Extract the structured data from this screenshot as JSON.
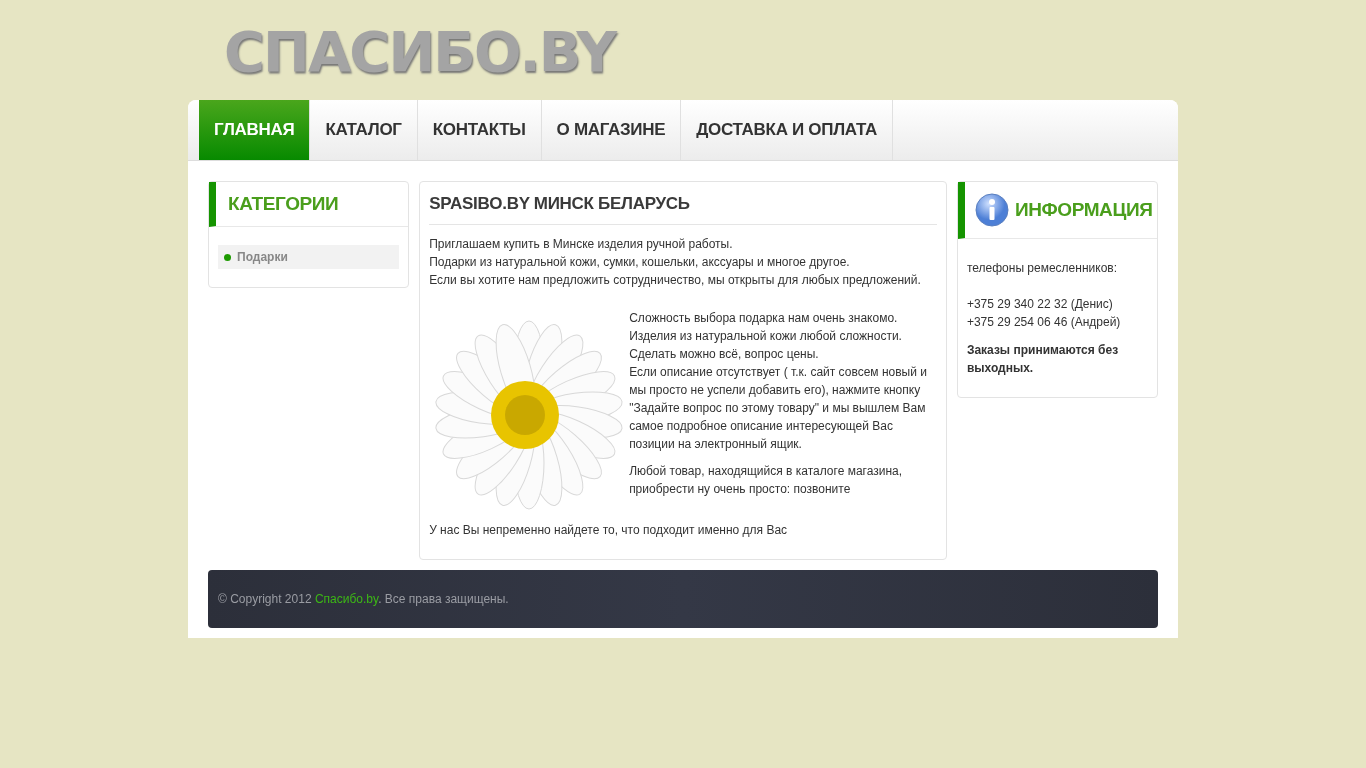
{
  "logo": {
    "text": "СПАСИБО.BY"
  },
  "nav": [
    {
      "label": "ГЛАВНАЯ",
      "selected": true
    },
    {
      "label": "КАТАЛОГ",
      "selected": false
    },
    {
      "label": "КОНТАКТЫ",
      "selected": false
    },
    {
      "label": "О МАГАЗИНЕ",
      "selected": false
    },
    {
      "label": "ДОСТАВКА И ОПЛАТА",
      "selected": false
    }
  ],
  "categories": {
    "title": "КАТЕГОРИИ",
    "items": [
      {
        "label": "Подарки",
        "selected": true
      }
    ]
  },
  "article": {
    "title": "SPASIBO.BY МИНСК БЕЛАРУСЬ",
    "intro": [
      "Приглашаем купить в Минске изделия ручной работы.",
      "Подарки из натуральной кожи, сумки, кошельки, акссуары и многое другое.",
      "Если вы хотите нам предложить сотрудничество, мы открыты для любых предложений."
    ],
    "paragraphs": [
      "Сложность выбора подарка нам очень знакомо.\nИзделия из натуральной кожи любой сложности.\nСделать можно всё, вопрос цены.\nЕсли описание отсутствует ( т.к. сайт совсем новый и мы просто не успели добавить его), нажмите кнопку \"Задайте вопрос по этому товару\" и мы вышлем Вам самое подробное описание интересующей Вас позиции на электронный ящик.",
      "Любой товар, находящийся в каталоге магазина, приобрести ну очень просто: позвоните"
    ],
    "closing": "У нас Вы непременно найдете то, что подходит именно для Вас"
  },
  "info": {
    "title": "ИНФОРМАЦИЯ",
    "label": "телефоны ремесленников:",
    "phones": [
      "+375 29 340 22 32 (Денис)",
      "+375 29 254 06 46 (Андрей)"
    ],
    "note": "Заказы принимаются без выходных."
  },
  "footer": {
    "prefix": "© Copyright 2012 ",
    "link": "Спасибо.by",
    "suffix": ". Все права защищены."
  }
}
